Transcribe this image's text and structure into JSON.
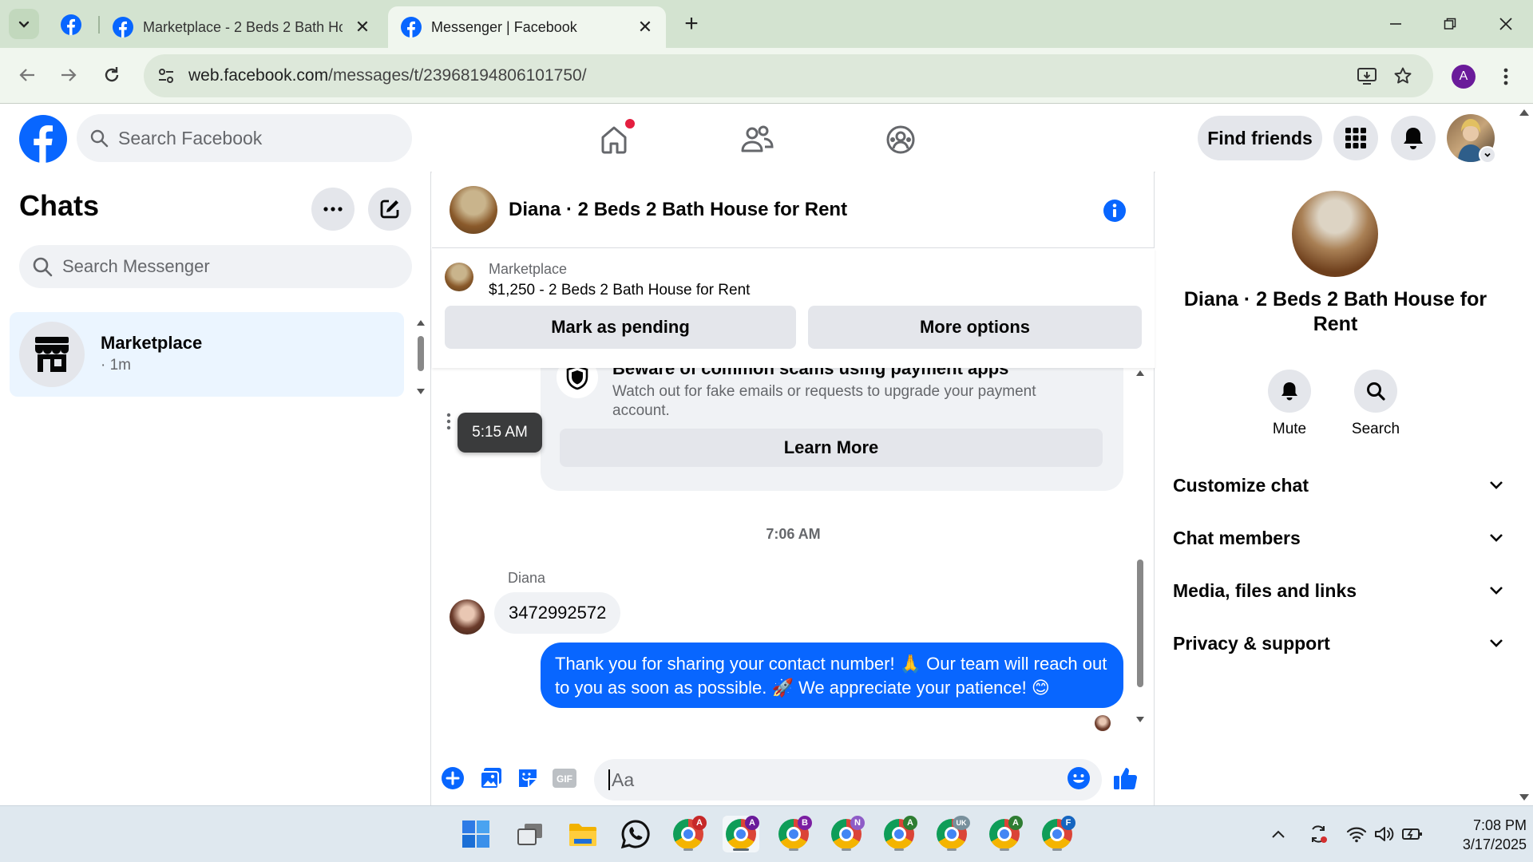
{
  "browser": {
    "tabs": [
      {
        "title": "Marketplace - 2 Beds 2 Bath Ho",
        "active": false
      },
      {
        "title": "Messenger | Facebook",
        "active": true
      }
    ],
    "url_host": "web.facebook.com",
    "url_path": "/messages/t/23968194806101750/",
    "profile_initial": "A"
  },
  "fb_header": {
    "search_placeholder": "Search Facebook",
    "find_friends": "Find friends"
  },
  "chats": {
    "title": "Chats",
    "search_placeholder": "Search Messenger",
    "items": [
      {
        "name": "Marketplace",
        "time": "· 1m"
      }
    ]
  },
  "conversation": {
    "title": "Diana · 2 Beds 2 Bath House for Rent",
    "marketplace_label": "Marketplace",
    "listing": "$1,250 - 2 Beds 2 Bath House for Rent",
    "mark_pending": "Mark as pending",
    "more_options": "More options",
    "scam_title": "Beware of common scams using payment apps",
    "scam_text": "Watch out for fake emails or requests to upgrade your payment account.",
    "learn_more": "Learn More",
    "tooltip_time": "5:15 AM",
    "timestamp": "7:06 AM",
    "sender": "Diana",
    "incoming_message": "3472992572",
    "outgoing_message": "Thank you for sharing your contact number! 🙏 Our team will reach out to you as soon as possible. 🚀 We appreciate your patience! 😊",
    "composer_placeholder": "Aa"
  },
  "details": {
    "title": "Diana · 2 Beds 2 Bath House for Rent",
    "mute": "Mute",
    "search": "Search",
    "sections": [
      "Customize chat",
      "Chat members",
      "Media, files and links",
      "Privacy & support"
    ]
  },
  "taskbar": {
    "chrome_badges": [
      "A",
      "A",
      "B",
      "N",
      "A",
      "UK",
      "A",
      "F"
    ],
    "time": "7:08 PM",
    "date": "3/17/2025"
  },
  "colors": {
    "facebook_blue": "#0866ff",
    "chat_active_bg": "#ebf5ff",
    "notification_red": "#e41e3f"
  }
}
